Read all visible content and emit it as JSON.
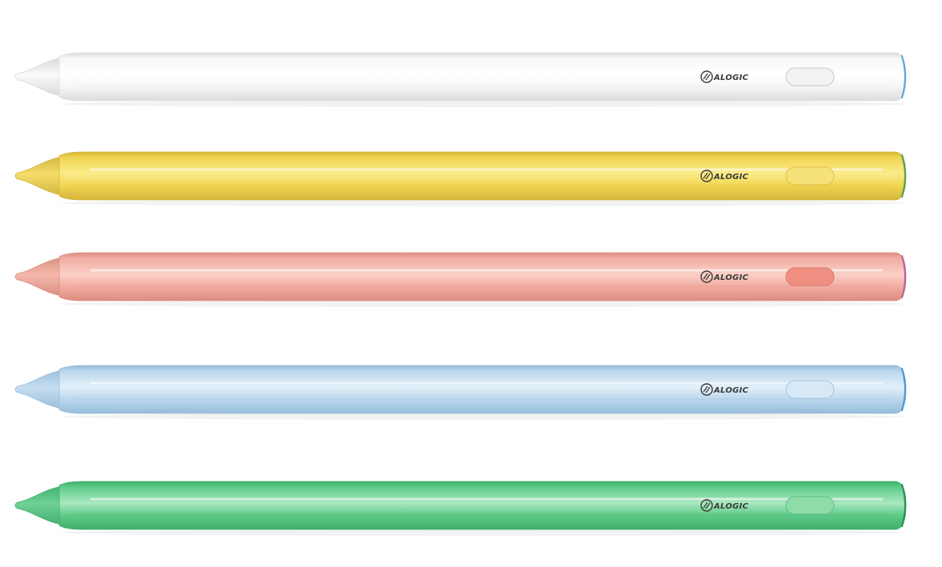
{
  "scene": {
    "description_brand": "ALOGIC",
    "background": "#ffffff"
  },
  "pencils": [
    {
      "brand": "ALOGIC",
      "color_name": "white",
      "body": "#f7f7f7",
      "body_light": "#ffffff",
      "body_dark": "#dcdcdc",
      "tip": "#fafafa",
      "tip_dark": "#d9d9d9",
      "button": "#f2f2f2",
      "button_edge": "#c8c8c8",
      "cap_ring": "#59a9d9",
      "logo": "#3a3a3a"
    },
    {
      "brand": "ALOGIC",
      "color_name": "yellow",
      "body": "#f1d552",
      "body_light": "#fbeb8a",
      "body_dark": "#d4b53a",
      "tip": "#f5dd6b",
      "tip_dark": "#d2b640",
      "button": "#f6e278",
      "button_edge": "#dcc04d",
      "cap_ring": "#4fa35a",
      "logo": "#3a3a3a"
    },
    {
      "brand": "ALOGIC",
      "color_name": "pink",
      "body": "#f2ada2",
      "body_light": "#fbd0c7",
      "body_dark": "#dc8d80",
      "tip": "#f5b8ad",
      "tip_dark": "#d8917f",
      "button": "#ef8f82",
      "button_edge": "#d9786c",
      "cap_ring": "#b565a0",
      "logo": "#3a3a3a"
    },
    {
      "brand": "ALOGIC",
      "color_name": "blue",
      "body": "#bcd7ec",
      "body_light": "#e3f0f9",
      "body_dark": "#97bddb",
      "tip": "#c6def0",
      "tip_dark": "#9dbedc",
      "button": "#d7e9f6",
      "button_edge": "#a7c7e2",
      "cap_ring": "#4d9ad6",
      "logo": "#3a3a3a"
    },
    {
      "brand": "ALOGIC",
      "color_name": "green",
      "body": "#5fcb89",
      "body_light": "#a9e8c0",
      "body_dark": "#3fae6b",
      "tip": "#6fd196",
      "tip_dark": "#45b072",
      "button": "#8fdca9",
      "button_edge": "#5ec184",
      "cap_ring": "#2f8f58",
      "logo": "#3a3a3a"
    }
  ]
}
